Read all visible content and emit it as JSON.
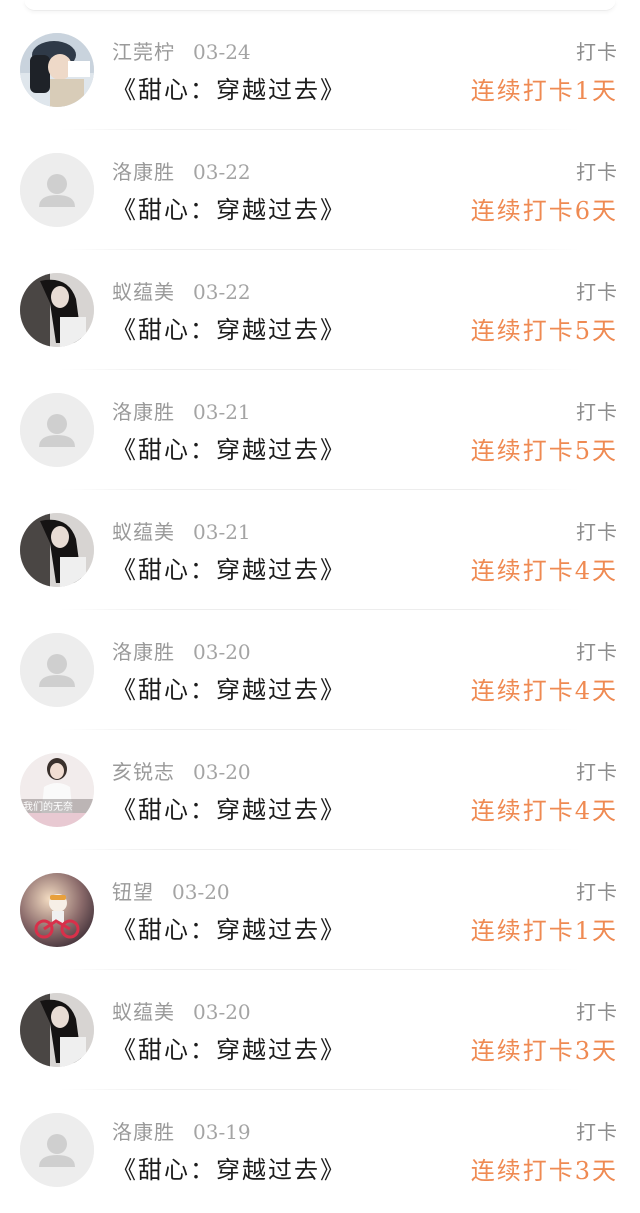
{
  "checkin_list": [
    {
      "user": "江莞柠",
      "date": "03-24",
      "book": "《甜心：穿越过去》",
      "action": "打卡",
      "streak": "连续打卡1天",
      "avatar": "photo-girl-cap"
    },
    {
      "user": "洛康胜",
      "date": "03-22",
      "book": "《甜心：穿越过去》",
      "action": "打卡",
      "streak": "连续打卡6天",
      "avatar": "default-user-icon"
    },
    {
      "user": "蚁蕴美",
      "date": "03-22",
      "book": "《甜心：穿越过去》",
      "action": "打卡",
      "streak": "连续打卡5天",
      "avatar": "photo-dark-hair"
    },
    {
      "user": "洛康胜",
      "date": "03-21",
      "book": "《甜心：穿越过去》",
      "action": "打卡",
      "streak": "连续打卡5天",
      "avatar": "default-user-icon"
    },
    {
      "user": "蚁蕴美",
      "date": "03-21",
      "book": "《甜心：穿越过去》",
      "action": "打卡",
      "streak": "连续打卡4天",
      "avatar": "photo-dark-hair"
    },
    {
      "user": "洛康胜",
      "date": "03-20",
      "book": "《甜心：穿越过去》",
      "action": "打卡",
      "streak": "连续打卡4天",
      "avatar": "default-user-icon"
    },
    {
      "user": "亥锐志",
      "date": "03-20",
      "book": "《甜心：穿越过去》",
      "action": "打卡",
      "streak": "连续打卡4天",
      "avatar": "photo-girl-white"
    },
    {
      "user": "钮望",
      "date": "03-20",
      "book": "《甜心：穿越过去》",
      "action": "打卡",
      "streak": "连续打卡1天",
      "avatar": "photo-cartoon-bike"
    },
    {
      "user": "蚁蕴美",
      "date": "03-20",
      "book": "《甜心：穿越过去》",
      "action": "打卡",
      "streak": "连续打卡3天",
      "avatar": "photo-dark-hair"
    },
    {
      "user": "洛康胜",
      "date": "03-19",
      "book": "《甜心：穿越过去》",
      "action": "打卡",
      "streak": "连续打卡3天",
      "avatar": "default-user-icon"
    }
  ],
  "avatar_label_text": "我们的无奈",
  "colors": {
    "streak": "#ef8a52",
    "name": "#9a9a9a",
    "book": "#1c1c1c",
    "action": "#8c8c8c"
  }
}
